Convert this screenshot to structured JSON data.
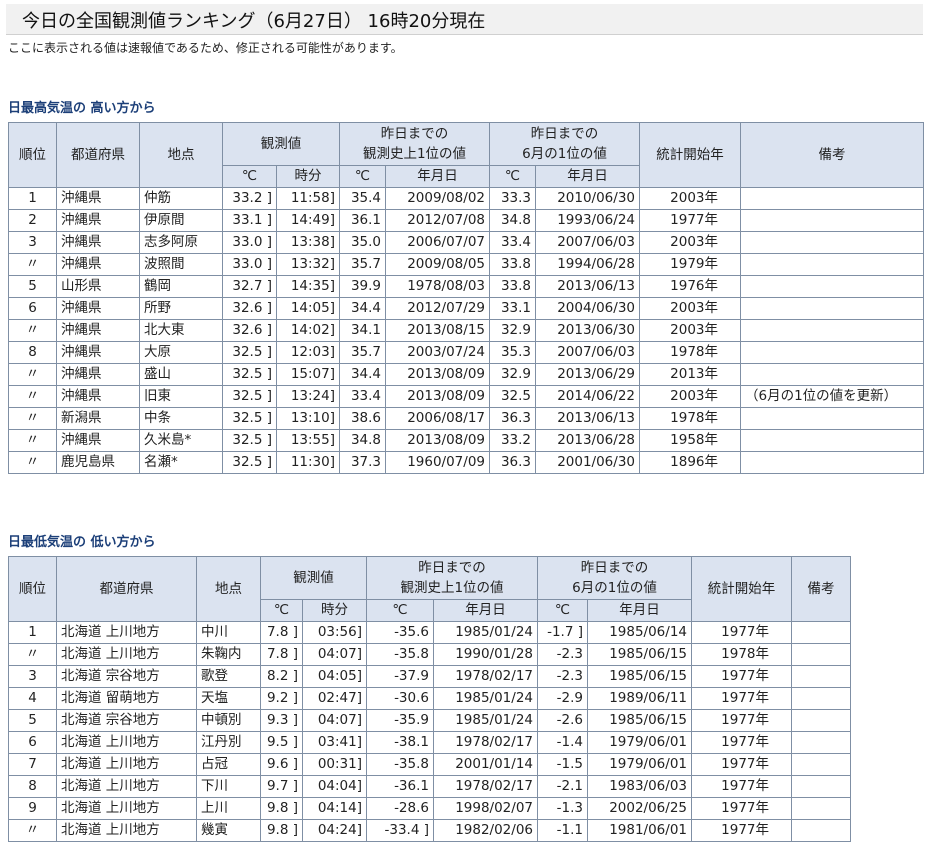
{
  "header": {
    "title": "今日の全国観測値ランキング（6月27日） 16時20分現在",
    "notice": "ここに表示される値は速報値であるため、修正される可能性があります。"
  },
  "high": {
    "section_title": "日最高気温の 高い方から",
    "headers": {
      "rank": "順位",
      "pref": "都道府県",
      "place": "地点",
      "obs": "観測値",
      "hist_top": "昨日までの",
      "hist_bottom": "観測史上1位の値",
      "june_top": "昨日までの",
      "june_bottom": "6月の1位の値",
      "start": "統計開始年",
      "note": "備考",
      "deg": "℃",
      "time": "時分",
      "ymd": "年月日"
    },
    "rows": [
      {
        "rank": "1",
        "pref": "沖縄県",
        "place": "仲筋",
        "temp": "33.2 ]",
        "time": "11:58]",
        "hist_temp": "35.4",
        "hist_date": "2009/08/02",
        "june_temp": "33.3",
        "june_date": "2010/06/30",
        "start": "2003年",
        "note": ""
      },
      {
        "rank": "2",
        "pref": "沖縄県",
        "place": "伊原間",
        "temp": "33.1 ]",
        "time": "14:49]",
        "hist_temp": "36.1",
        "hist_date": "2012/07/08",
        "june_temp": "34.8",
        "june_date": "1993/06/24",
        "start": "1977年",
        "note": ""
      },
      {
        "rank": "3",
        "pref": "沖縄県",
        "place": "志多阿原",
        "temp": "33.0 ]",
        "time": "13:38]",
        "hist_temp": "35.0",
        "hist_date": "2006/07/07",
        "june_temp": "33.4",
        "june_date": "2007/06/03",
        "start": "2003年",
        "note": ""
      },
      {
        "rank": "〃",
        "pref": "沖縄県",
        "place": "波照間",
        "temp": "33.0 ]",
        "time": "13:32]",
        "hist_temp": "35.7",
        "hist_date": "2009/08/05",
        "june_temp": "33.8",
        "june_date": "1994/06/28",
        "start": "1979年",
        "note": ""
      },
      {
        "rank": "5",
        "pref": "山形県",
        "place": "鶴岡",
        "temp": "32.7 ]",
        "time": "14:35]",
        "hist_temp": "39.9",
        "hist_date": "1978/08/03",
        "june_temp": "33.8",
        "june_date": "2013/06/13",
        "start": "1976年",
        "note": ""
      },
      {
        "rank": "6",
        "pref": "沖縄県",
        "place": "所野",
        "temp": "32.6 ]",
        "time": "14:05]",
        "hist_temp": "34.4",
        "hist_date": "2012/07/29",
        "june_temp": "33.1",
        "june_date": "2004/06/30",
        "start": "2003年",
        "note": ""
      },
      {
        "rank": "〃",
        "pref": "沖縄県",
        "place": "北大東",
        "temp": "32.6 ]",
        "time": "14:02]",
        "hist_temp": "34.1",
        "hist_date": "2013/08/15",
        "june_temp": "32.9",
        "june_date": "2013/06/30",
        "start": "2003年",
        "note": ""
      },
      {
        "rank": "8",
        "pref": "沖縄県",
        "place": "大原",
        "temp": "32.5 ]",
        "time": "12:03]",
        "hist_temp": "35.7",
        "hist_date": "2003/07/24",
        "june_temp": "35.3",
        "june_date": "2007/06/03",
        "start": "1978年",
        "note": ""
      },
      {
        "rank": "〃",
        "pref": "沖縄県",
        "place": "盛山",
        "temp": "32.5 ]",
        "time": "15:07]",
        "hist_temp": "34.4",
        "hist_date": "2013/08/09",
        "june_temp": "32.9",
        "june_date": "2013/06/29",
        "start": "2013年",
        "note": ""
      },
      {
        "rank": "〃",
        "pref": "沖縄県",
        "place": "旧東",
        "temp": "32.5 ]",
        "time": "13:24]",
        "hist_temp": "33.4",
        "hist_date": "2013/08/09",
        "june_temp": "32.5",
        "june_date": "2014/06/22",
        "start": "2003年",
        "note": "（6月の1位の値を更新）"
      },
      {
        "rank": "〃",
        "pref": "新潟県",
        "place": "中条",
        "temp": "32.5 ]",
        "time": "13:10]",
        "hist_temp": "38.6",
        "hist_date": "2006/08/17",
        "june_temp": "36.3",
        "june_date": "2013/06/13",
        "start": "1978年",
        "note": ""
      },
      {
        "rank": "〃",
        "pref": "沖縄県",
        "place": "久米島*",
        "temp": "32.5 ]",
        "time": "13:55]",
        "hist_temp": "34.8",
        "hist_date": "2013/08/09",
        "june_temp": "33.2",
        "june_date": "2013/06/28",
        "start": "1958年",
        "note": ""
      },
      {
        "rank": "〃",
        "pref": "鹿児島県",
        "place": "名瀬*",
        "temp": "32.5 ]",
        "time": "11:30]",
        "hist_temp": "37.3",
        "hist_date": "1960/07/09",
        "june_temp": "36.3",
        "june_date": "2001/06/30",
        "start": "1896年",
        "note": ""
      }
    ]
  },
  "low": {
    "section_title": "日最低気温の 低い方から",
    "headers": {
      "rank": "順位",
      "pref": "都道府県",
      "place": "地点",
      "obs": "観測値",
      "hist_top": "昨日までの",
      "hist_bottom": "観測史上1位の値",
      "june_top": "昨日までの",
      "june_bottom": "6月の1位の値",
      "start": "統計開始年",
      "note": "備考",
      "deg": "℃",
      "time": "時分",
      "ymd": "年月日"
    },
    "rows": [
      {
        "rank": "1",
        "pref": "北海道 上川地方",
        "place": "中川",
        "temp": "7.8 ]",
        "time": "03:56]",
        "hist_temp": "-35.6",
        "hist_date": "1985/01/24",
        "june_temp": "-1.7 ]",
        "june_date": "1985/06/14",
        "start": "1977年",
        "note": ""
      },
      {
        "rank": "〃",
        "pref": "北海道 上川地方",
        "place": "朱鞠内",
        "temp": "7.8 ]",
        "time": "04:07]",
        "hist_temp": "-35.8",
        "hist_date": "1990/01/28",
        "june_temp": "-2.3",
        "june_date": "1985/06/15",
        "start": "1978年",
        "note": ""
      },
      {
        "rank": "3",
        "pref": "北海道 宗谷地方",
        "place": "歌登",
        "temp": "8.2 ]",
        "time": "04:05]",
        "hist_temp": "-37.9",
        "hist_date": "1978/02/17",
        "june_temp": "-2.3",
        "june_date": "1985/06/15",
        "start": "1977年",
        "note": ""
      },
      {
        "rank": "4",
        "pref": "北海道 留萌地方",
        "place": "天塩",
        "temp": "9.2 ]",
        "time": "02:47]",
        "hist_temp": "-30.6",
        "hist_date": "1985/01/24",
        "june_temp": "-2.9",
        "june_date": "1989/06/11",
        "start": "1977年",
        "note": ""
      },
      {
        "rank": "5",
        "pref": "北海道 宗谷地方",
        "place": "中頓別",
        "temp": "9.3 ]",
        "time": "04:07]",
        "hist_temp": "-35.9",
        "hist_date": "1985/01/24",
        "june_temp": "-2.6",
        "june_date": "1985/06/15",
        "start": "1977年",
        "note": ""
      },
      {
        "rank": "6",
        "pref": "北海道 上川地方",
        "place": "江丹別",
        "temp": "9.5 ]",
        "time": "03:41]",
        "hist_temp": "-38.1",
        "hist_date": "1978/02/17",
        "june_temp": "-1.4",
        "june_date": "1979/06/01",
        "start": "1977年",
        "note": ""
      },
      {
        "rank": "7",
        "pref": "北海道 上川地方",
        "place": "占冠",
        "temp": "9.6 ]",
        "time": "00:31]",
        "hist_temp": "-35.8",
        "hist_date": "2001/01/14",
        "june_temp": "-1.5",
        "june_date": "1979/06/01",
        "start": "1977年",
        "note": ""
      },
      {
        "rank": "8",
        "pref": "北海道 上川地方",
        "place": "下川",
        "temp": "9.7 ]",
        "time": "04:04]",
        "hist_temp": "-36.1",
        "hist_date": "1978/02/17",
        "june_temp": "-2.1",
        "june_date": "1983/06/03",
        "start": "1977年",
        "note": ""
      },
      {
        "rank": "9",
        "pref": "北海道 上川地方",
        "place": "上川",
        "temp": "9.8 ]",
        "time": "04:14]",
        "hist_temp": "-28.6",
        "hist_date": "1998/02/07",
        "june_temp": "-1.3",
        "june_date": "2002/06/25",
        "start": "1977年",
        "note": ""
      },
      {
        "rank": "〃",
        "pref": "北海道 上川地方",
        "place": "幾寅",
        "temp": "9.8 ]",
        "time": "04:24]",
        "hist_temp": "-33.4 ]",
        "hist_date": "1982/02/06",
        "june_temp": "-1.1",
        "june_date": "1981/06/01",
        "start": "1977年",
        "note": ""
      }
    ]
  }
}
